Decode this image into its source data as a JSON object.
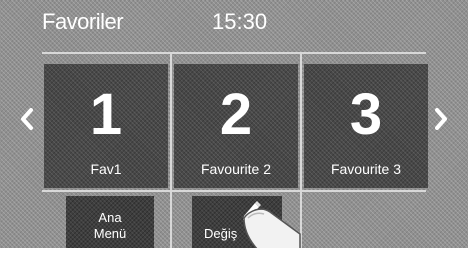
{
  "header": {
    "title": "Favoriler",
    "clock": "15:30"
  },
  "navigation": {
    "prev_icon": "chevron-left-icon",
    "next_icon": "chevron-right-icon"
  },
  "favorites": [
    {
      "number": "1",
      "label": "Fav1"
    },
    {
      "number": "2",
      "label": "Favourite 2"
    },
    {
      "number": "3",
      "label": "Favourite 3"
    }
  ],
  "buttons": {
    "main_menu_line1": "Ana",
    "main_menu_line2": "Menü",
    "edit_label": "Değiş",
    "edit_icon": "pencil-icon"
  },
  "colors": {
    "background": "#909090",
    "tile": "#484848",
    "text": "#ffffff"
  }
}
